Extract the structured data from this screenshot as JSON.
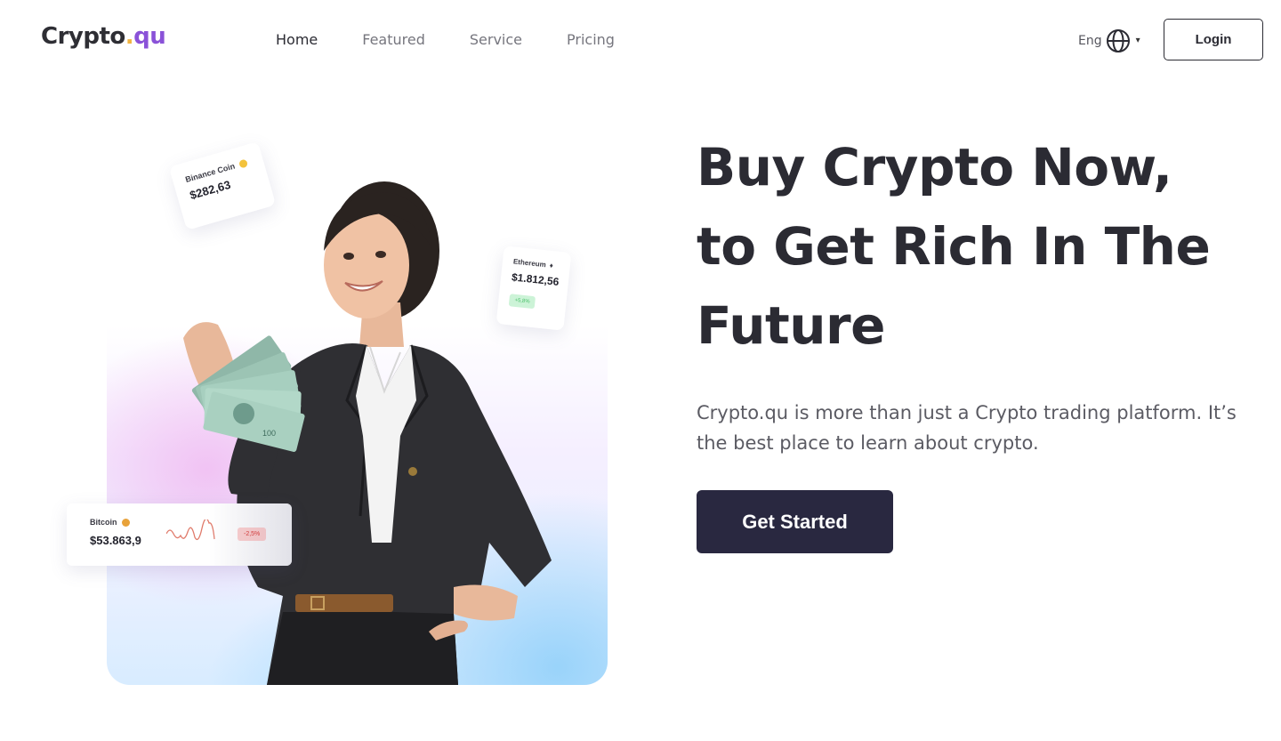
{
  "brand": {
    "name": "Crypto",
    "dot": ".",
    "suffix": "qu"
  },
  "nav": {
    "items": [
      {
        "label": "Home",
        "active": true
      },
      {
        "label": "Featured",
        "active": false
      },
      {
        "label": "Service",
        "active": false
      },
      {
        "label": "Pricing",
        "active": false
      }
    ]
  },
  "language": {
    "label": "Eng",
    "icon": "globe-icon",
    "caret": "▾"
  },
  "login": {
    "label": "Login"
  },
  "hero": {
    "headline": "Buy Crypto Now, to Get Rich In The Future",
    "description": "Crypto.qu is more than just a Crypto trading platform. It’s the best place to learn about crypto.",
    "cta": "Get Started"
  },
  "ticker_cards": {
    "binance": {
      "name": "Binance Coin",
      "price": "$282,63",
      "icon": "binance-coin-icon"
    },
    "ethereum": {
      "name": "Ethereum",
      "price": "$1.812,56",
      "change": "+5,8%",
      "icon": "ethereum-icon"
    },
    "bitcoin": {
      "name": "Bitcoin",
      "price": "$53.863,9",
      "change": "-2,5%",
      "icon": "bitcoin-icon"
    }
  },
  "colors": {
    "accent_purple": "#8a52d8",
    "accent_gold": "#f2b441",
    "cta_background": "#292840",
    "text_dark": "#2b2b33",
    "text_muted": "#5b5b63",
    "positive": "#4cc16b",
    "negative": "#d23d3d"
  }
}
